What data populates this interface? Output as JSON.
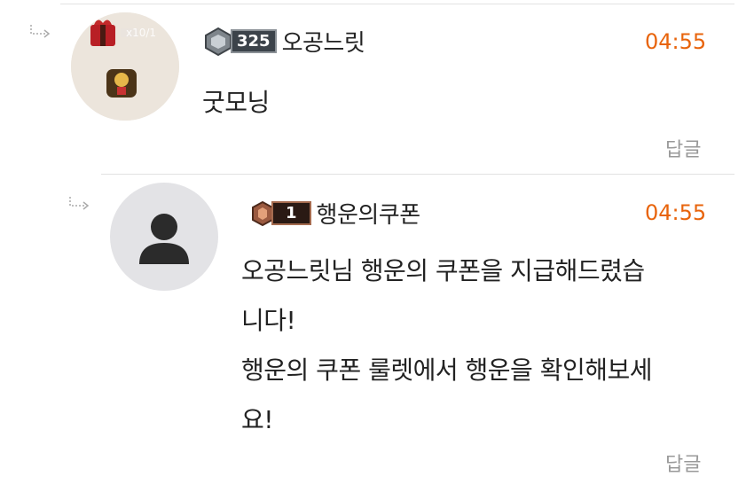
{
  "comments": [
    {
      "username": "오공느릿",
      "level": "325",
      "time": "04:55",
      "text": "굿모닝",
      "reply_label": "답글",
      "avatar_badge_count": "x10/1"
    },
    {
      "username": "행운의쿠폰",
      "level": "1",
      "time": "04:55",
      "text_lines": [
        "오공느릿님 행운의 쿠폰을 지급해드렸습",
        "니다!",
        "행운의 쿠폰 룰렛에서 행운을 확인해보세",
        "요!"
      ],
      "reply_label": "답글"
    }
  ],
  "colors": {
    "time": "#e8640c",
    "reply": "#999999",
    "divider": "#e2e2e2"
  }
}
